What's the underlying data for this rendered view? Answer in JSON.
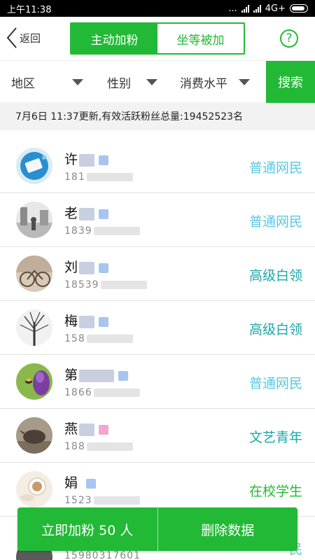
{
  "status_bar": {
    "time": "上午11:38",
    "dots": "...",
    "network": "4G+"
  },
  "header": {
    "back_label": "返回",
    "tabs": [
      {
        "label": "主动加粉",
        "active": true
      },
      {
        "label": "坐等被加",
        "active": false
      }
    ],
    "help_label": "?"
  },
  "filters": {
    "region": "地区",
    "gender": "性别",
    "consumption": "消费水平",
    "search_label": "搜索"
  },
  "info_text": "7月6日 11:37更新,有效活跃粉丝总量:19452523名",
  "colors": {
    "brand_green": "#22b936",
    "tag_blue": "#5bc8e0",
    "tag_teal": "#1aa8a8",
    "tag_green": "#22b936"
  },
  "fans": [
    {
      "name": "许",
      "phone": "181",
      "tag": "普通网民",
      "tag_color": "#5bc8e0",
      "avatar_icon": "phone-photo-icon"
    },
    {
      "name": "老",
      "phone": "1839",
      "tag": "普通网民",
      "tag_color": "#5bc8e0",
      "avatar_icon": "street-photo-icon"
    },
    {
      "name": "刘",
      "phone": "18539",
      "tag": "高级白领",
      "tag_color": "#1aa8a8",
      "avatar_icon": "bicycle-photo-icon"
    },
    {
      "name": "梅",
      "phone": "158",
      "tag": "高级白领",
      "tag_color": "#1aa8a8",
      "avatar_icon": "tree-photo-icon"
    },
    {
      "name": "第",
      "phone": "1866",
      "tag": "普通网民",
      "tag_color": "#5bc8e0",
      "avatar_icon": "bee-flower-icon"
    },
    {
      "name": "燕",
      "phone": "188",
      "tag": "文艺青年",
      "tag_color": "#1aa8a8",
      "avatar_icon": "rhino-photo-icon"
    },
    {
      "name": "娟",
      "phone": "1523",
      "tag": "在校学生",
      "tag_color": "#22b936",
      "avatar_icon": "cup-photo-icon"
    }
  ],
  "peek_row": {
    "phone": "15980317601",
    "tag": "民"
  },
  "actions": {
    "add_label": "立即加粉 50 人",
    "delete_label": "删除数据"
  }
}
